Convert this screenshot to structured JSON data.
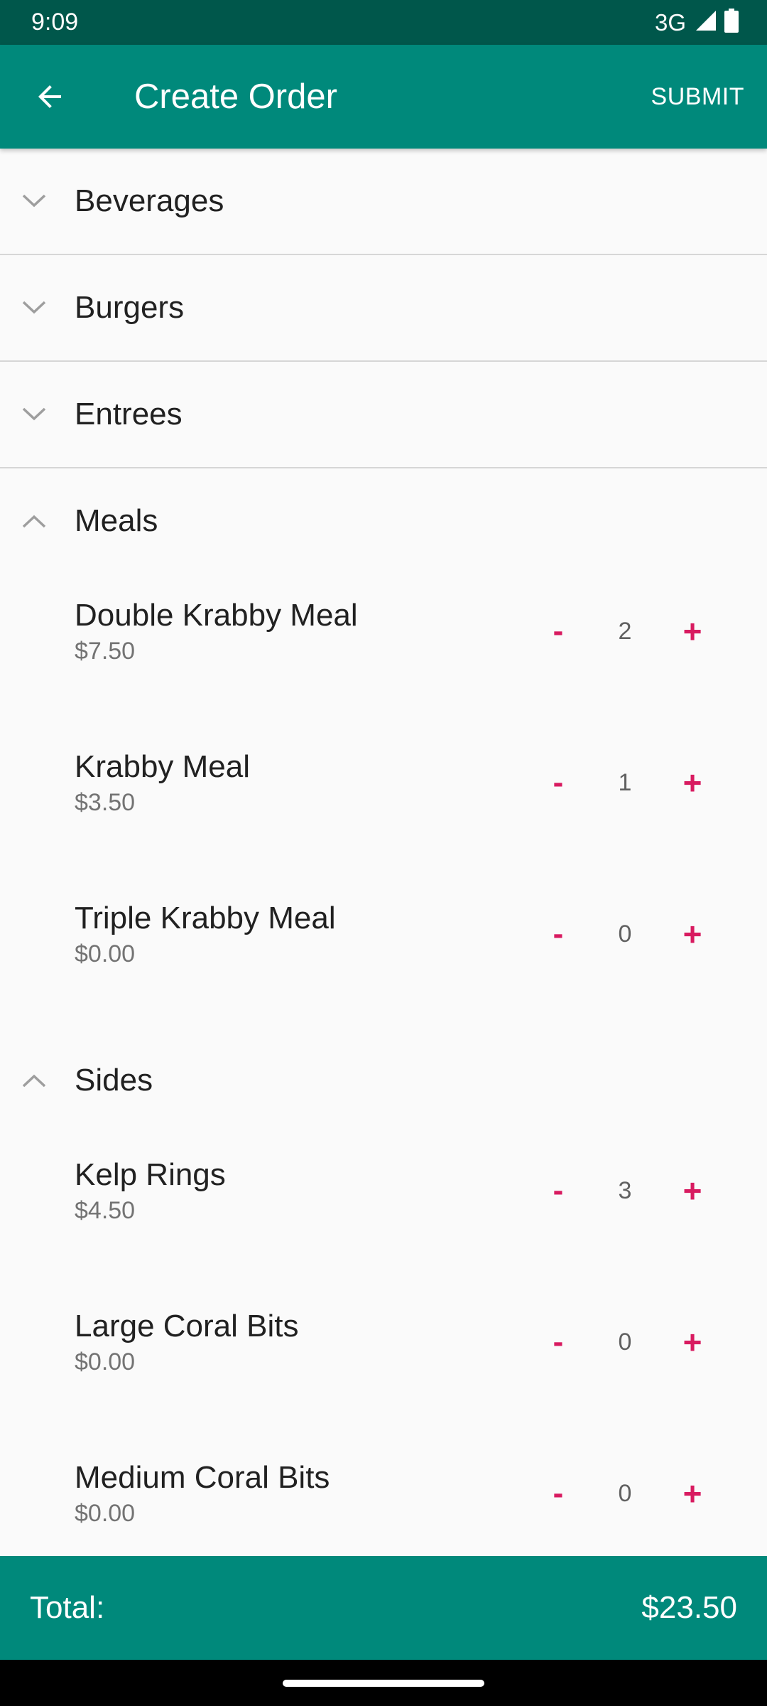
{
  "status_bar": {
    "time": "9:09",
    "network": "3G",
    "signal_icon": "signal-icon",
    "battery_icon": "battery-icon"
  },
  "app_bar": {
    "back_icon": "arrow-left-icon",
    "title": "Create Order",
    "action_label": "SUBMIT"
  },
  "colors": {
    "primary": "#00897b",
    "primary_dark": "#00574b",
    "accent": "#d81b60",
    "background": "#fafafa"
  },
  "groups": [
    {
      "label": "Beverages",
      "expanded": false
    },
    {
      "label": "Burgers",
      "expanded": false
    },
    {
      "label": "Entrees",
      "expanded": false
    },
    {
      "label": "Meals",
      "expanded": true,
      "items": [
        {
          "name": "Double Krabby Meal",
          "price": "$7.50",
          "quantity": "2"
        },
        {
          "name": "Krabby Meal",
          "price": "$3.50",
          "quantity": "1"
        },
        {
          "name": "Triple Krabby Meal",
          "price": "$0.00",
          "quantity": "0"
        }
      ]
    },
    {
      "label": "Sides",
      "expanded": true,
      "items": [
        {
          "name": "Kelp Rings",
          "price": "$4.50",
          "quantity": "3"
        },
        {
          "name": "Large Coral Bits",
          "price": "$0.00",
          "quantity": "0"
        },
        {
          "name": "Medium Coral Bits",
          "price": "$0.00",
          "quantity": "0"
        }
      ]
    }
  ],
  "stepper": {
    "minus_label": "-",
    "plus_label": "+"
  },
  "total": {
    "label": "Total:",
    "value": "$23.50"
  }
}
